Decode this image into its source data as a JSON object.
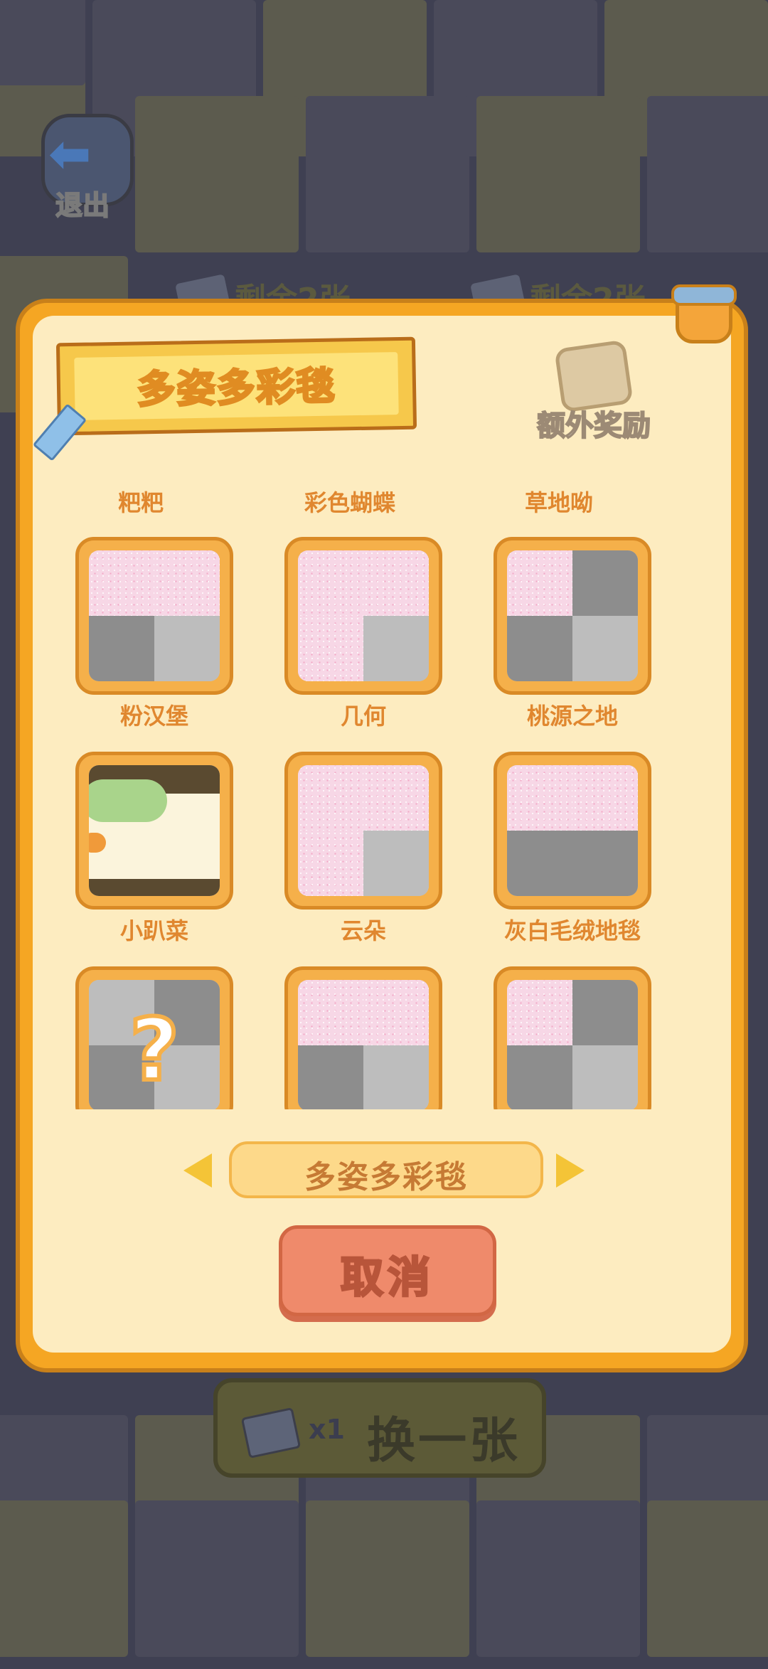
{
  "topbar": {
    "exit_label": "退出"
  },
  "background": {
    "remain_left": "剩余2张",
    "remain_right": "剩余2张"
  },
  "dialog": {
    "title": "多姿多彩毯",
    "bonus_label": "额外奖励",
    "top_row_names": [
      "粑粑",
      "彩色蝴蝶",
      "草地呦"
    ],
    "items": [
      {
        "name": "粉汉堡",
        "state": "partial"
      },
      {
        "name": "几何",
        "state": "partial"
      },
      {
        "name": "桃源之地",
        "state": "partial"
      },
      {
        "name": "小趴菜",
        "state": "complete"
      },
      {
        "name": "云朵",
        "state": "partial"
      },
      {
        "name": "灰白毛绒地毯",
        "state": "partial"
      },
      {
        "name": "",
        "state": "locked"
      },
      {
        "name": "",
        "state": "partial"
      },
      {
        "name": "",
        "state": "partial"
      }
    ],
    "selector": {
      "current": "多姿多彩毯"
    },
    "cancel_label": "取消"
  },
  "swap": {
    "count": "x1",
    "label": "换一张"
  }
}
